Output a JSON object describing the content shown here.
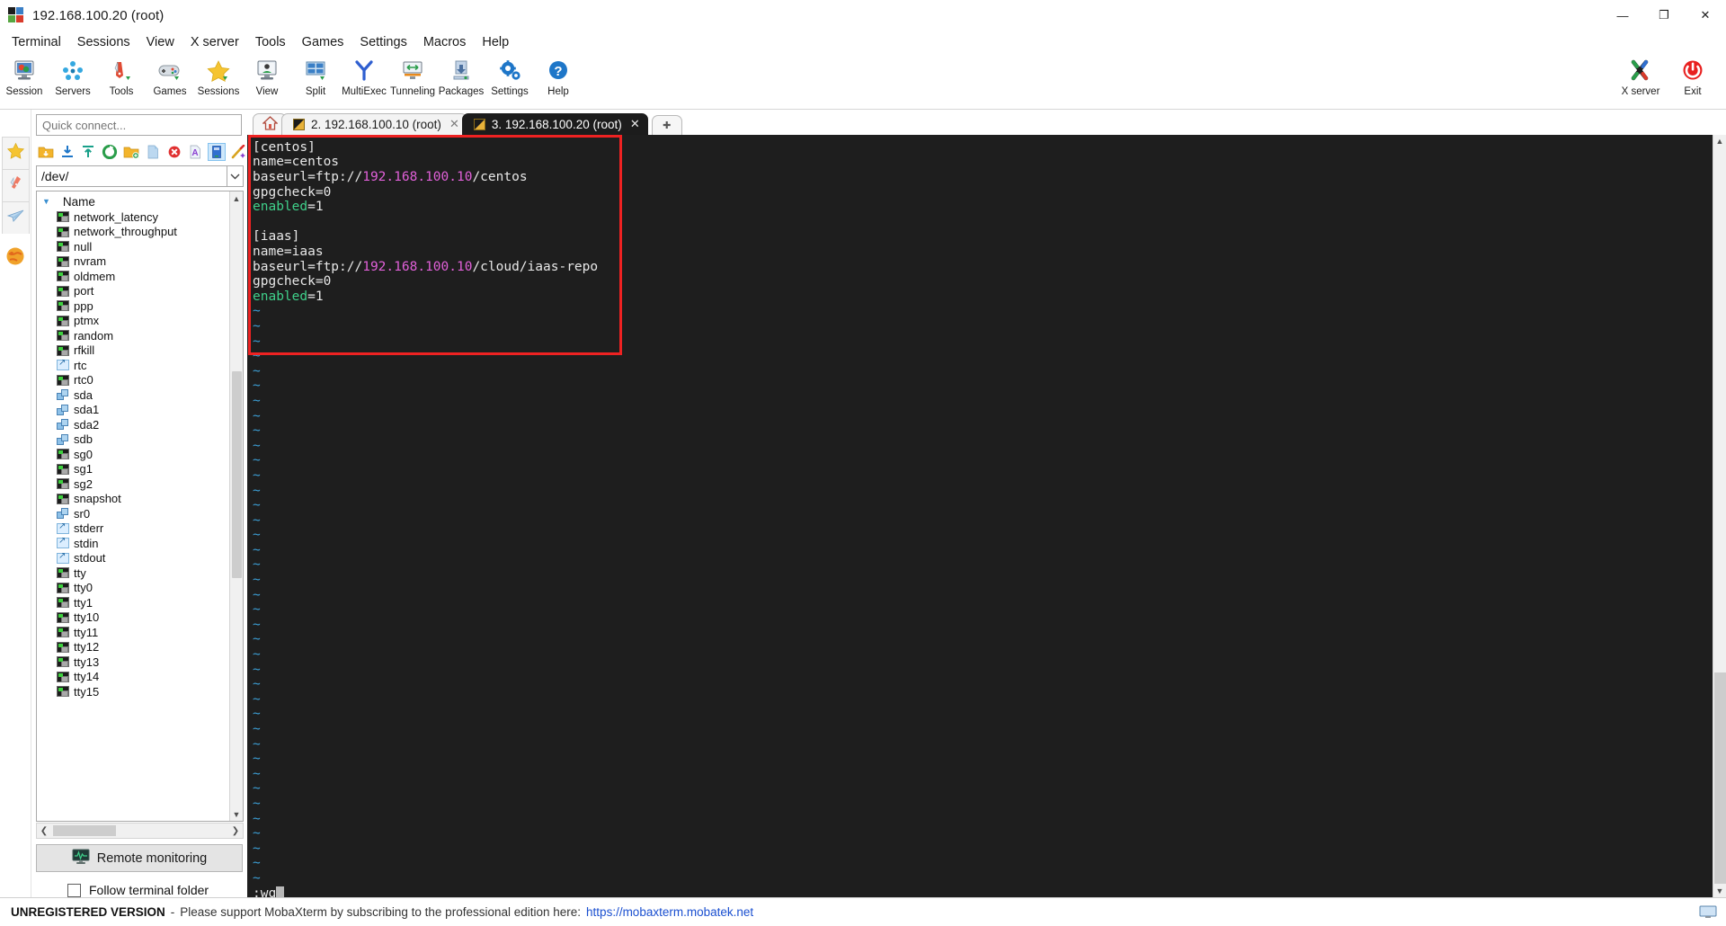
{
  "window": {
    "title": "192.168.100.20 (root)",
    "controls": {
      "minimize": "—",
      "restore": "❐",
      "close": "✕"
    }
  },
  "menubar": {
    "items": [
      "Terminal",
      "Sessions",
      "View",
      "X server",
      "Tools",
      "Games",
      "Settings",
      "Macros",
      "Help"
    ]
  },
  "ribbon": {
    "items": [
      {
        "label": "Session",
        "icon": "session-icon"
      },
      {
        "label": "Servers",
        "icon": "servers-icon"
      },
      {
        "label": "Tools",
        "icon": "tools-icon"
      },
      {
        "label": "Games",
        "icon": "games-icon"
      },
      {
        "label": "Sessions",
        "icon": "sessions-star-icon"
      },
      {
        "label": "View",
        "icon": "view-icon"
      },
      {
        "label": "Split",
        "icon": "split-icon"
      },
      {
        "label": "MultiExec",
        "icon": "multiexec-icon"
      },
      {
        "label": "Tunneling",
        "icon": "tunneling-icon"
      },
      {
        "label": "Packages",
        "icon": "packages-icon"
      },
      {
        "label": "Settings",
        "icon": "settings-gear-icon"
      },
      {
        "label": "Help",
        "icon": "help-icon"
      }
    ],
    "right_items": [
      {
        "label": "X server",
        "icon": "x-server-icon"
      },
      {
        "label": "Exit",
        "icon": "exit-power-icon"
      }
    ]
  },
  "rail": {
    "buttons": [
      "favorites-star-icon",
      "tools-knife-icon",
      "sftp-plane-icon"
    ],
    "globe": "macros-globe-icon"
  },
  "sidebar": {
    "quick_connect_placeholder": "Quick connect...",
    "toolbar_icons": [
      "parent-folder-icon",
      "download-icon",
      "upload-icon",
      "refresh-icon",
      "new-folder-icon",
      "new-file-icon",
      "delete-icon",
      "text-view-icon",
      "terminal-view-icon",
      "magic-wand-icon"
    ],
    "path": "/dev/",
    "column_header": "Name",
    "files": [
      {
        "name": "network_latency",
        "type": "chardev"
      },
      {
        "name": "network_throughput",
        "type": "chardev"
      },
      {
        "name": "null",
        "type": "chardev"
      },
      {
        "name": "nvram",
        "type": "chardev"
      },
      {
        "name": "oldmem",
        "type": "chardev"
      },
      {
        "name": "port",
        "type": "chardev"
      },
      {
        "name": "ppp",
        "type": "chardev"
      },
      {
        "name": "ptmx",
        "type": "chardev"
      },
      {
        "name": "random",
        "type": "chardev"
      },
      {
        "name": "rfkill",
        "type": "chardev"
      },
      {
        "name": "rtc",
        "type": "link"
      },
      {
        "name": "rtc0",
        "type": "chardev"
      },
      {
        "name": "sda",
        "type": "block"
      },
      {
        "name": "sda1",
        "type": "block"
      },
      {
        "name": "sda2",
        "type": "block"
      },
      {
        "name": "sdb",
        "type": "block"
      },
      {
        "name": "sg0",
        "type": "chardev"
      },
      {
        "name": "sg1",
        "type": "chardev"
      },
      {
        "name": "sg2",
        "type": "chardev"
      },
      {
        "name": "snapshot",
        "type": "chardev"
      },
      {
        "name": "sr0",
        "type": "block"
      },
      {
        "name": "stderr",
        "type": "link"
      },
      {
        "name": "stdin",
        "type": "link"
      },
      {
        "name": "stdout",
        "type": "link"
      },
      {
        "name": "tty",
        "type": "chardev"
      },
      {
        "name": "tty0",
        "type": "chardev"
      },
      {
        "name": "tty1",
        "type": "chardev"
      },
      {
        "name": "tty10",
        "type": "chardev"
      },
      {
        "name": "tty11",
        "type": "chardev"
      },
      {
        "name": "tty12",
        "type": "chardev"
      },
      {
        "name": "tty13",
        "type": "chardev"
      },
      {
        "name": "tty14",
        "type": "chardev"
      },
      {
        "name": "tty15",
        "type": "chardev"
      }
    ],
    "remote_monitoring_label": "Remote monitoring",
    "follow_terminal_folder_label": "Follow terminal folder",
    "follow_terminal_folder_checked": false
  },
  "tabs": {
    "home_icon": "home-icon",
    "items": [
      {
        "label": "2. 192.168.100.10 (root)",
        "active": false
      },
      {
        "label": "3. 192.168.100.20 (root)",
        "active": true
      }
    ],
    "new_tab_label": "✚"
  },
  "terminal": {
    "lines": [
      [
        {
          "t": "[centos]",
          "c": "white"
        }
      ],
      [
        {
          "t": "name=centos",
          "c": "white"
        }
      ],
      [
        {
          "t": "baseurl=ftp://",
          "c": "white"
        },
        {
          "t": "192.168.100.10",
          "c": "magenta"
        },
        {
          "t": "/centos",
          "c": "white"
        }
      ],
      [
        {
          "t": "gpgcheck=0",
          "c": "white"
        }
      ],
      [
        {
          "t": "enabled",
          "c": "green"
        },
        {
          "t": "=1",
          "c": "white"
        }
      ],
      [
        {
          "t": "",
          "c": "white"
        }
      ],
      [
        {
          "t": "[iaas]",
          "c": "white"
        }
      ],
      [
        {
          "t": "name=iaas",
          "c": "white"
        }
      ],
      [
        {
          "t": "baseurl=ftp://",
          "c": "white"
        },
        {
          "t": "192.168.100.10",
          "c": "magenta"
        },
        {
          "t": "/cloud/iaas-repo",
          "c": "white"
        }
      ],
      [
        {
          "t": "gpgcheck=0",
          "c": "white"
        }
      ],
      [
        {
          "t": "enabled",
          "c": "green"
        },
        {
          "t": "=1",
          "c": "white"
        }
      ]
    ],
    "tilde_count": 39,
    "tilde_char": "~",
    "command_line": ":wq",
    "highlight_box": {
      "color": "#ee2222"
    }
  },
  "statusbar": {
    "badge": "UNREGISTERED VERSION",
    "separator": "-",
    "message": "Please support MobaXterm by subscribing to the professional edition here:",
    "link": "https://mobaxterm.mobatek.net"
  }
}
